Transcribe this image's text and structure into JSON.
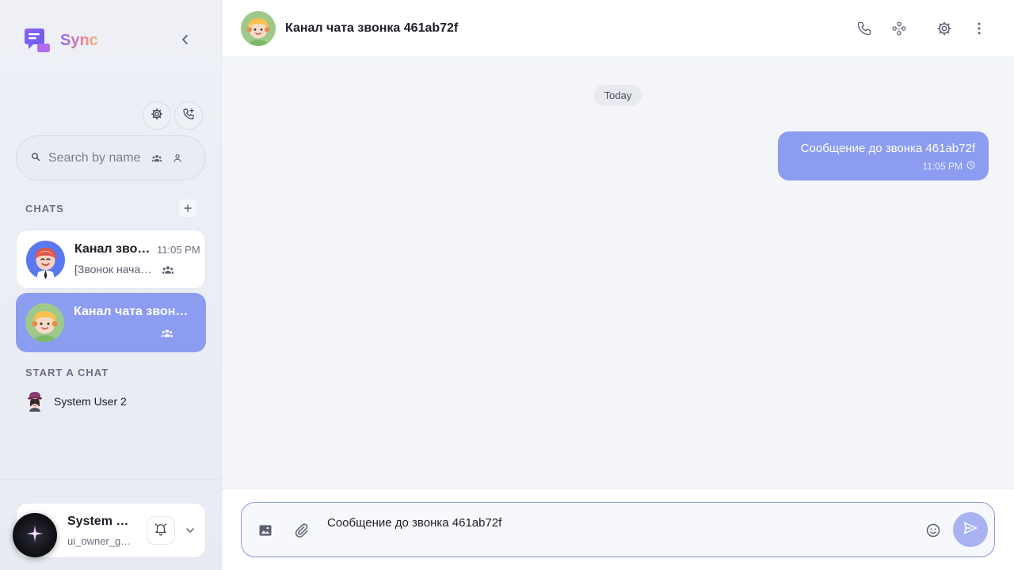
{
  "brand": {
    "name": "Sync"
  },
  "search": {
    "placeholder": "Search by name"
  },
  "sections": {
    "chats": "CHATS",
    "start_chat": "START A CHAT"
  },
  "chats": [
    {
      "title": "Канал зво…",
      "time": "11:05 PM",
      "preview": "[Звонок нача…",
      "active": false
    },
    {
      "title": "Канал чата звонк…",
      "time": "",
      "preview": "",
      "active": true
    }
  ],
  "start_users": [
    {
      "label": "System User 2"
    }
  ],
  "current_user": {
    "name": "System U…",
    "id": "ui_owner_g…"
  },
  "channel": {
    "title": "Канал чата звонка 461ab72f"
  },
  "conversation": {
    "date_label": "Today",
    "messages": [
      {
        "text": "Сообщение до звонка 461ab72f",
        "time": "11:05 PM",
        "status": "pending-clock-icon"
      }
    ]
  },
  "composer": {
    "value": "Сообщение до звонка 461ab72f"
  },
  "colors": {
    "accent": "#8c9df1",
    "send": "#a9b3f2",
    "bg": "#f4f5f8"
  }
}
